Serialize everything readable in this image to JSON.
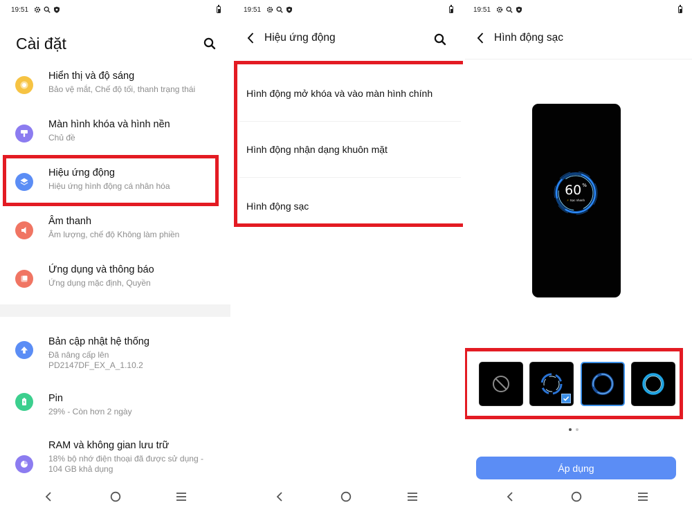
{
  "status_bar": {
    "time": "19:51"
  },
  "settings": {
    "title": "Cài đặt",
    "group1": [
      {
        "title": "Hiển thị và độ sáng",
        "subtitle": "Bảo vệ mắt, Chế độ tối, thanh trạng thái",
        "icon": "sun-icon",
        "color": "#f6c343"
      },
      {
        "title": "Màn hình khóa và hình nền",
        "subtitle": "Chủ đề",
        "icon": "brush-icon",
        "color": "#8c7cf0"
      },
      {
        "title": "Hiệu ứng động",
        "subtitle": "Hiệu ứng hình động cá nhân hóa",
        "icon": "layers-icon",
        "color": "#5b8df5"
      },
      {
        "title": "Âm thanh",
        "subtitle": "Âm lượng, chế độ Không làm phiền",
        "icon": "speaker-icon",
        "color": "#f07563"
      },
      {
        "title": "Ứng dụng và thông báo",
        "subtitle": "Ứng dụng mặc định, Quyền",
        "icon": "apps-icon",
        "color": "#f07563"
      }
    ],
    "group2": [
      {
        "title": "Bản cập nhật hệ thống",
        "subtitle_line1": "Đã nâng cấp lên",
        "subtitle_line2": "PD2147DF_EX_A_1.10.2",
        "icon": "update-arrow-icon",
        "color": "#5b8df5"
      },
      {
        "title": "Pin",
        "subtitle": "29% - Còn hơn 2 ngày",
        "icon": "battery-icon",
        "color": "#3ccf8e"
      },
      {
        "title": "RAM và không gian lưu trữ",
        "subtitle_line1": "18% bộ nhớ điện thoại đã được sử dụng -",
        "subtitle_line2": "104 GB khả dụng",
        "icon": "storage-pie-icon",
        "color": "#8c7cf0"
      }
    ]
  },
  "animations": {
    "title": "Hiệu ứng động",
    "items": [
      "Hình động mở khóa và vào màn hình chính",
      "Hình động nhận dạng khuôn mặt",
      "Hình động sạc"
    ]
  },
  "charging": {
    "title": "Hình động sạc",
    "preview_percent": "60",
    "preview_unit": "%",
    "preview_label": "Sạc nhanh",
    "options": [
      "none",
      "ring-style-1",
      "ring-style-2",
      "ring-style-3"
    ],
    "checked_option": 1,
    "selected_option": 2,
    "page_index": 0,
    "page_count": 2,
    "apply_label": "Áp dụng"
  },
  "colors": {
    "accent": "#5b8df5",
    "highlight": "#e31b23"
  }
}
